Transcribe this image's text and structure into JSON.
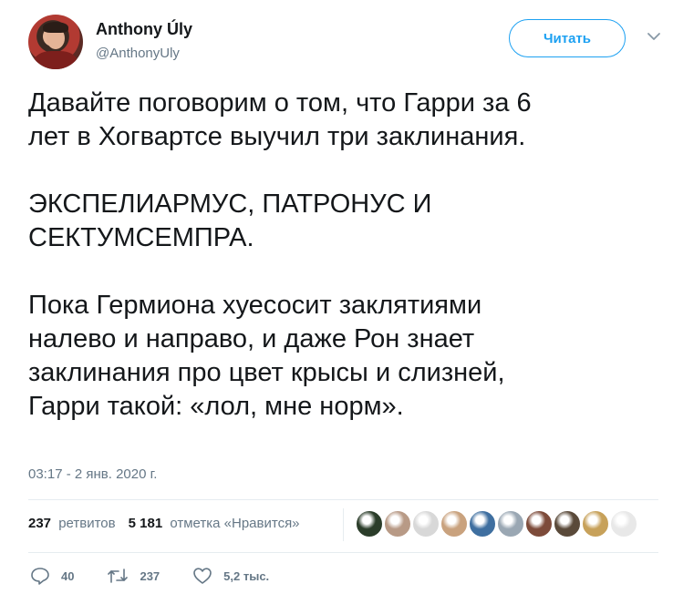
{
  "author": {
    "name": "Anthony Úly",
    "handle": "@AnthonyUly"
  },
  "follow_button_label": "Читать",
  "tweet": {
    "text": "Давайте поговорим о том, что Гарри за 6\nлет в Хогвартсе выучил три заклинания.\n\nЭКСПЕЛИАРМУС, ПАТРОНУС И\nСЕКТУМСЕМПРА.\n\nПока Гермиона хуесосит заклятиями\nналево и направо, и даже Рон знает\nзаклинания про цвет крысы и слизней,\nГарри такой: «лол, мне норм».",
    "timestamp": "03:17 - 2 янв. 2020 г."
  },
  "stats": {
    "retweets_count": "237",
    "retweets_label": "ретвитов",
    "likes_count": "5 181",
    "likes_label": "отметка «Нравится»"
  },
  "liker_avatar_colors": [
    "#2b3d2a",
    "#b89a86",
    "#d8d8d8",
    "#c9a27e",
    "#3f6fa0",
    "#9aa7b3",
    "#7d4b3a",
    "#5a4a3a",
    "#c7a15a",
    "#e8e8e8"
  ],
  "actions": {
    "reply_count": "40",
    "retweet_count": "237",
    "like_count": "5,2 тыс."
  },
  "colors": {
    "accent": "#1da1f2",
    "secondary_text": "#657786",
    "primary_text": "#14171a",
    "divider": "#e6ecf0"
  }
}
